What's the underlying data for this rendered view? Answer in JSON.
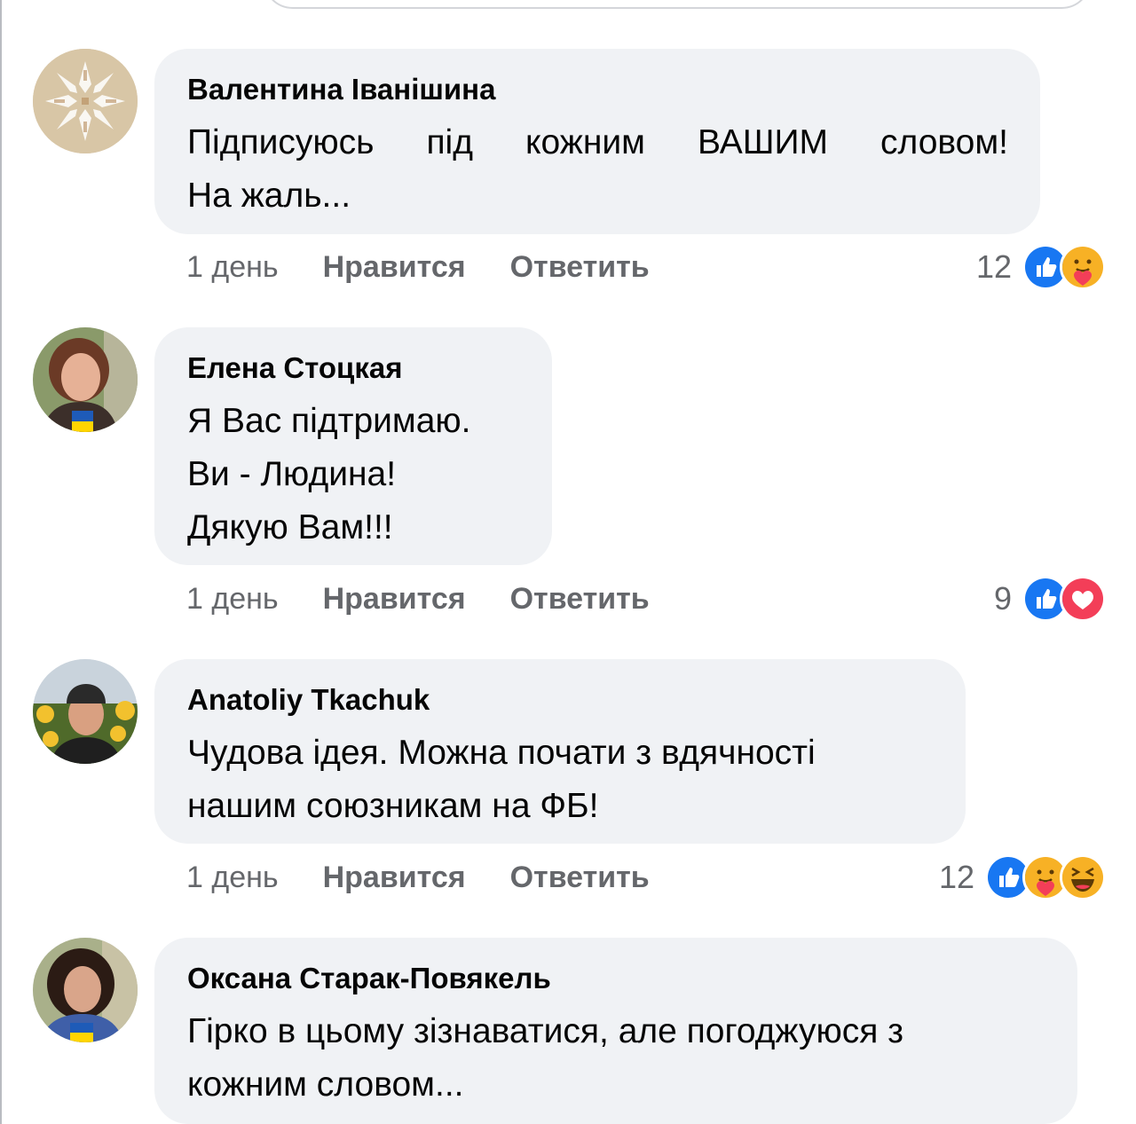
{
  "comments": [
    {
      "author": "Валентина Іванішина",
      "lines": [
        "Підписуюсь під кожним ВАШИМ словом!",
        "На жаль..."
      ],
      "time": "1 день",
      "like_label": "Нравится",
      "reply_label": "Ответить",
      "reaction_count": "12",
      "reaction_icons": [
        "like-icon",
        "care-icon"
      ]
    },
    {
      "author": "Елена Стоцкая",
      "lines": [
        "Я Вас підтримаю.",
        "Ви - Людина!",
        "Дякую Вам!!!"
      ],
      "time": "1 день",
      "like_label": "Нравится",
      "reply_label": "Ответить",
      "reaction_count": "9",
      "reaction_icons": [
        "like-icon",
        "love-icon"
      ]
    },
    {
      "author": "Anatoliy Tkachuk",
      "lines": [
        "Чудова ідея. Можна почати з вдячності",
        "нашим союзникам на ФБ!"
      ],
      "time": "1 день",
      "like_label": "Нравится",
      "reply_label": "Ответить",
      "reaction_count": "12",
      "reaction_icons": [
        "like-icon",
        "care-icon",
        "haha-icon"
      ]
    },
    {
      "author": "Оксана Старак-Повякель",
      "lines": [
        "Гірко в цьому зізнаватися, але погоджуюся з",
        "кожним словом..."
      ]
    }
  ],
  "colors": {
    "bubble": "#f0f2f5",
    "meta_text": "#65676b",
    "like_blue": "#1877f2",
    "love_red": "#f33e58",
    "emoji_yellow": "#f7b125"
  }
}
